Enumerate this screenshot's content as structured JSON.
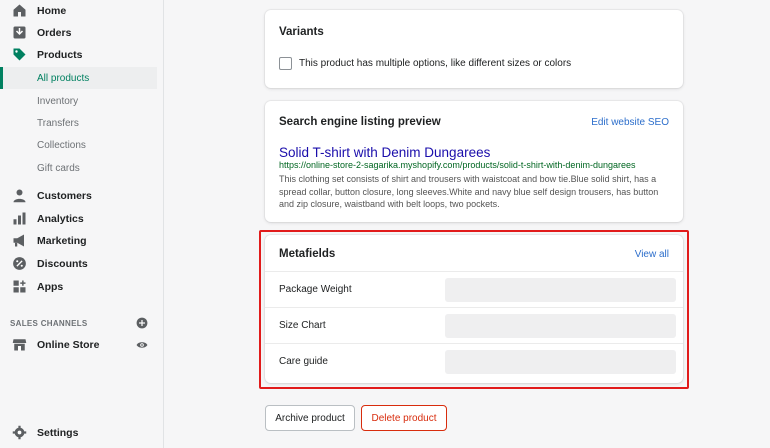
{
  "sidebar": {
    "nav": [
      {
        "label": "Home",
        "icon": "home-icon"
      },
      {
        "label": "Orders",
        "icon": "orders-icon"
      },
      {
        "label": "Products",
        "icon": "tag-icon"
      }
    ],
    "products_sub": [
      "All products",
      "Inventory",
      "Transfers",
      "Collections",
      "Gift cards"
    ],
    "nav2": [
      {
        "label": "Customers",
        "icon": "person-icon"
      },
      {
        "label": "Analytics",
        "icon": "bar-chart-icon"
      },
      {
        "label": "Marketing",
        "icon": "megaphone-icon"
      },
      {
        "label": "Discounts",
        "icon": "discount-icon"
      },
      {
        "label": "Apps",
        "icon": "apps-icon"
      }
    ],
    "sales_channels_title": "SALES CHANNELS",
    "online_store": "Online Store",
    "settings": "Settings"
  },
  "variants": {
    "title": "Variants",
    "checkbox_label": "This product has multiple options, like different sizes or colors"
  },
  "seo": {
    "title": "Search engine listing preview",
    "edit_link": "Edit website SEO",
    "preview_title": "Solid T-shirt with Denim Dungarees",
    "preview_url": "https://online-store-2-sagarika.myshopify.com/products/solid-t-shirt-with-denim-dungarees",
    "preview_desc": "This clothing set consists of shirt and trousers with waistcoat and bow tie.Blue solid shirt, has a spread collar, button closure, long sleeves.White and navy blue self design trousers, has button and zip closure, waistband with belt loops, two pockets."
  },
  "metafields": {
    "title": "Metafields",
    "view_all": "View all",
    "rows": [
      {
        "label": "Package Weight",
        "value": ""
      },
      {
        "label": "Size Chart",
        "value": ""
      },
      {
        "label": "Care guide",
        "value": ""
      }
    ]
  },
  "actions": {
    "archive": "Archive product",
    "delete": "Delete product"
  },
  "colors": {
    "accent": "#008060",
    "link": "#2c6ecb",
    "danger": "#d82c0d",
    "highlight": "#e11b1b"
  }
}
